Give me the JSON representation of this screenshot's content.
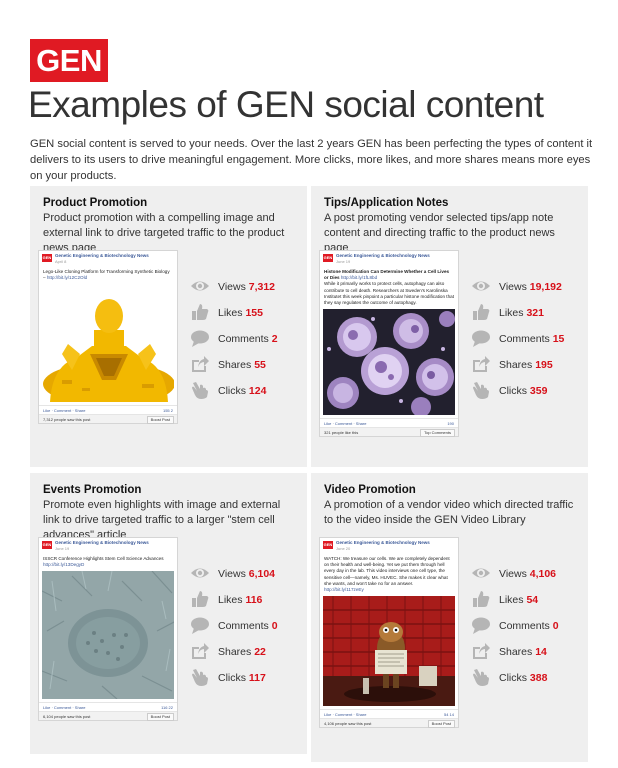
{
  "logo": "GEN",
  "headline": "Examples of GEN social content",
  "intro": "GEN social content is served to your needs. Over the last 2 years GEN has been perfecting the types of content it delivers to its users to drive meaningful engagement. More clicks, more likes, and more shares means more eyes on your products.",
  "colors": {
    "brand_red": "#e01a23",
    "panel_bg": "#efefef",
    "stat_red": "#d7111a",
    "fb_blue": "#3b5998"
  },
  "stat_labels": {
    "views": "Views",
    "likes": "Likes",
    "comments": "Comments",
    "shares": "Shares",
    "clicks": "Clicks"
  },
  "stat_icons": [
    "eye-icon",
    "thumbs-up-icon",
    "comment-bubble-icon",
    "share-arrow-icon",
    "pointer-hand-icon"
  ],
  "post_common": {
    "page_name": "Genetic Engineering & Biotechnology News",
    "mini_logo": "GEN",
    "actions": "Like · Comment · Share",
    "boost": "Boost Post"
  },
  "panels": [
    {
      "title": "Product Promotion",
      "description": "Product promotion with a compelling image and external link to drive targeted traffic to the product news page",
      "post": {
        "date": "April 8",
        "text": "Lego-Like Cloning Platform for Transforming Synthetic Biology – ",
        "link": "http://bit.ly/12C2Old",
        "reactions": "155  2",
        "seen": "7,312 people saw this post"
      },
      "stats": {
        "views": "7,312",
        "likes": "155",
        "comments": "2",
        "shares": "55",
        "clicks": "124"
      }
    },
    {
      "title": "Tips/Application Notes",
      "description": "A post promoting vendor selected tips/app note content and directing traffic to the product news page",
      "post": {
        "date": "June 19",
        "text": "Histone Modification Can Determine Whether a Cell Lives or Dies ",
        "link": "http://bit.ly/1fL8bd",
        "text2": "While it primarily works to protect cells, autophagy can also contribute to cell death. Researchers at Sweden's Karolinska Institutet this week pinpoint a particular histone modification that they say regulates the outcome of autophagy.",
        "reactions": "190",
        "seen": "321 people like this",
        "comments_label": "Top Comments"
      },
      "stats": {
        "views": "19,192",
        "likes": "321",
        "comments": "15",
        "shares": "195",
        "clicks": "359"
      }
    },
    {
      "title": "Events Promotion",
      "description": "Promote even highlights with image and external link to drive targeted traffic to a larger \"stem cell advances\" article",
      "post": {
        "date": "June 19",
        "text": "ISSCR Conference Highlights Stem Cell Science Advances ",
        "link": "http://bit.ly/13DegyD",
        "reactions": "116  22",
        "seen": "6,104 people saw this post"
      },
      "stats": {
        "views": "6,104",
        "likes": "116",
        "comments": "0",
        "shares": "22",
        "clicks": "117"
      }
    },
    {
      "title": "Video Promotion",
      "description": "A promotion of a vendor video which directed traffic to the video inside the GEN Video Library",
      "post": {
        "date": "June 20",
        "text": "WATCH: We treasure our cells. We are completely dependent on their health and well-being. Yet we put them through hell every day in the lab. This video interviews one cell type, the sensitive cell—namely, Ms. HUVEC. She makes it clear what she wants, and won't take no for an answer. ",
        "link": "http://bit.ly/117zeEy",
        "reactions": "54  14",
        "seen": "4,106 people saw this post"
      },
      "stats": {
        "views": "4,106",
        "likes": "54",
        "comments": "0",
        "shares": "14",
        "clicks": "388"
      }
    }
  ]
}
